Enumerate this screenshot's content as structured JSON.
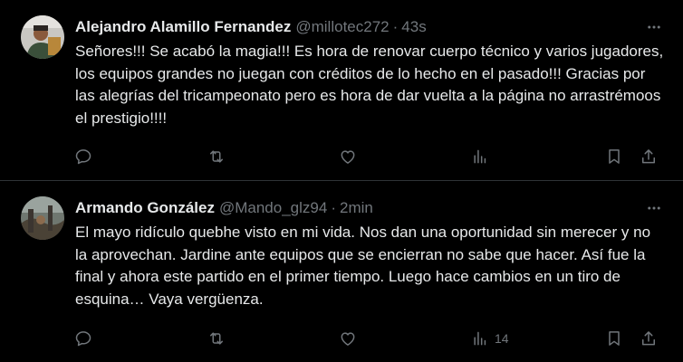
{
  "tweets": [
    {
      "display_name": "Alejandro Alamillo Fernandez",
      "handle": "@millotec272",
      "separator": "·",
      "time": "43s",
      "text": "Señores!!! Se acabó la magia!!! Es hora de renovar cuerpo técnico y varios jugadores, los equipos grandes no juegan con créditos de lo hecho en el pasado!!! Gracias por las alegrías del tricampeonato pero es hora de dar vuelta a la página no arrastrémoos el prestigio!!!!",
      "views": "",
      "icons": [
        "reply-icon",
        "retweet-icon",
        "like-icon",
        "views-icon",
        "bookmark-icon",
        "share-icon",
        "more-icon"
      ]
    },
    {
      "display_name": "Armando González",
      "handle": "@Mando_glz94",
      "separator": "·",
      "time": "2min",
      "text": "El mayo ridículo quebhe visto en mi vida. Nos dan una oportunidad sin merecer y no la aprovechan. Jardine ante equipos que se encierran no sabe que hacer. Así fue la final y ahora este partido en el primer tiempo. Luego hace cambios en un tiro de esquina… Vaya vergüenza.",
      "views": "14",
      "icons": [
        "reply-icon",
        "retweet-icon",
        "like-icon",
        "views-icon",
        "bookmark-icon",
        "share-icon",
        "more-icon"
      ]
    }
  ],
  "colors": {
    "background": "#000000",
    "text_primary": "#e7e9ea",
    "text_secondary": "#71767b",
    "divider": "#2f3336"
  }
}
